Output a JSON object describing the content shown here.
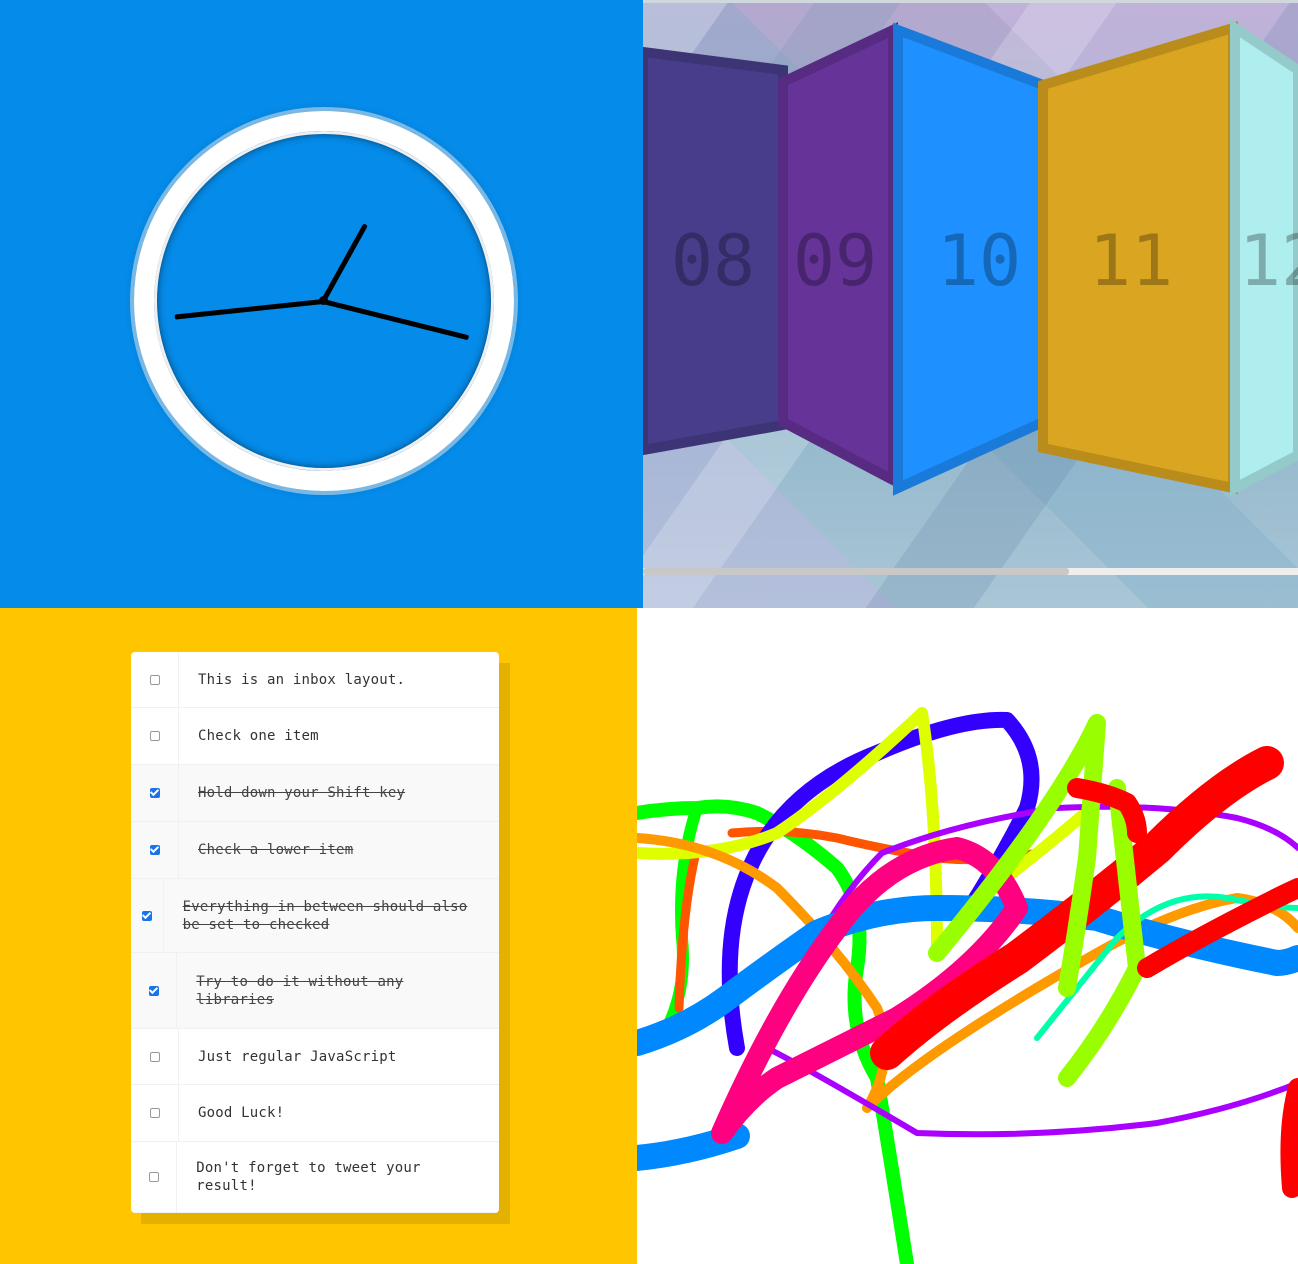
{
  "clock": {
    "face_color": "#ffffff",
    "background": "#058be9",
    "hands": [
      {
        "name": "hour-hand",
        "angle": -61
      },
      {
        "name": "minute-hand",
        "angle": 14
      },
      {
        "name": "second-hand",
        "angle": 174
      }
    ]
  },
  "flex_panels": {
    "panels": [
      {
        "label": "08",
        "color": "#483d8b"
      },
      {
        "label": "09",
        "color": "#663399"
      },
      {
        "label": "10",
        "color": "#1e90ff"
      },
      {
        "label": "11",
        "color": "#daa520"
      },
      {
        "label": "12",
        "color": "#afeeee"
      }
    ],
    "scroll_fraction": 0.65
  },
  "inbox": {
    "items": [
      {
        "text": "This is an inbox layout.",
        "checked": false
      },
      {
        "text": "Check one item",
        "checked": false
      },
      {
        "text": "Hold down your Shift key",
        "checked": true
      },
      {
        "text": "Check a lower item",
        "checked": true
      },
      {
        "text": "Everything in between should also be set to checked",
        "checked": true
      },
      {
        "text": "Try to do it without any libraries",
        "checked": true
      },
      {
        "text": "Just regular JavaScript",
        "checked": false
      },
      {
        "text": "Good Luck!",
        "checked": false
      },
      {
        "text": "Don't forget to tweet your result!",
        "checked": false
      }
    ]
  },
  "drawing": {
    "stroke_colors": [
      "#00ff00",
      "#ff5500",
      "#3300ff",
      "#ddff00",
      "#ff9900",
      "#aa00ff",
      "#0088ff",
      "#ff0080",
      "#ff0000",
      "#00ffaa",
      "#99ff00"
    ]
  }
}
